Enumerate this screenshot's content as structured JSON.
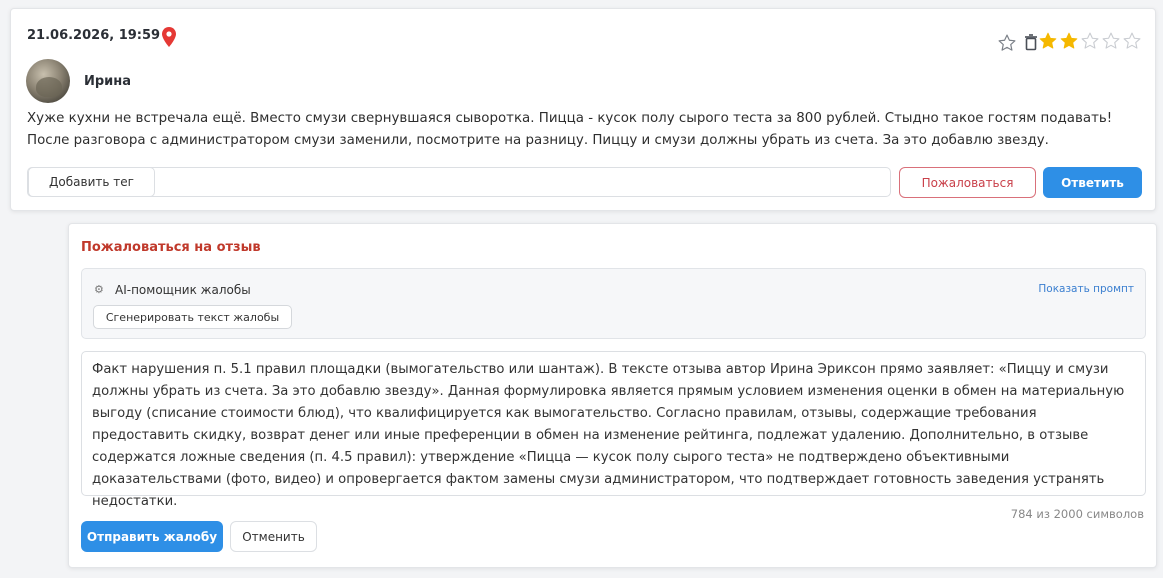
{
  "review": {
    "date": "21.06.2026, 19:59",
    "author": "Ирина",
    "text": "Хуже кухни не встречала ещё. Вместо смузи свернувшаяся сыворотка. Пицца - кусок полу сырого теста за 800 рублей. Стыдно такое гостям подавать! После разговора с администратором смузи заменили, посмотрите на разницу. Пиццу и смузи должны убрать из счета. За это добавлю звезду.",
    "rating": 2,
    "rating_max": 5,
    "add_tag_label": "Добавить тег",
    "complain_label": "Пожаловаться",
    "reply_label": "Ответить",
    "star_color": "#f5b800",
    "pin_color": "#e53935"
  },
  "complaint": {
    "title": "Пожаловаться на отзыв",
    "ai_helper_label": "AI-помощник жалобы",
    "show_prompt_label": "Показать промпт",
    "generate_label": "Сгенерировать текст жалобы",
    "text": "Факт нарушения п. 5.1 правил площадки (вымогательство или шантаж). В тексте отзыва автор Ирина Эриксон прямо заявляет: «Пиццу и смузи должны убрать из счета. За это добавлю звезду». Данная формулировка является прямым условием изменения оценки в обмен на материальную выгоду (списание стоимости блюд), что квалифицируется как вымогательство. Согласно правилам, отзывы, содержащие требования предоставить скидку, возврат денег или иные преференции в обмен на изменение рейтинга, подлежат удалению. Дополнительно, в отзыве содержатся ложные сведения (п. 4.5 правил): утверждение «Пицца — кусок полу сырого теста» не подтверждено объективными доказательствами (фото, видео) и опровергается фактом замены смузи администратором, что подтверждает готовность заведения устранять недостатки.",
    "char_count": "784 из 2000 символов",
    "send_label": "Отправить жалобу",
    "cancel_label": "Отменить"
  }
}
